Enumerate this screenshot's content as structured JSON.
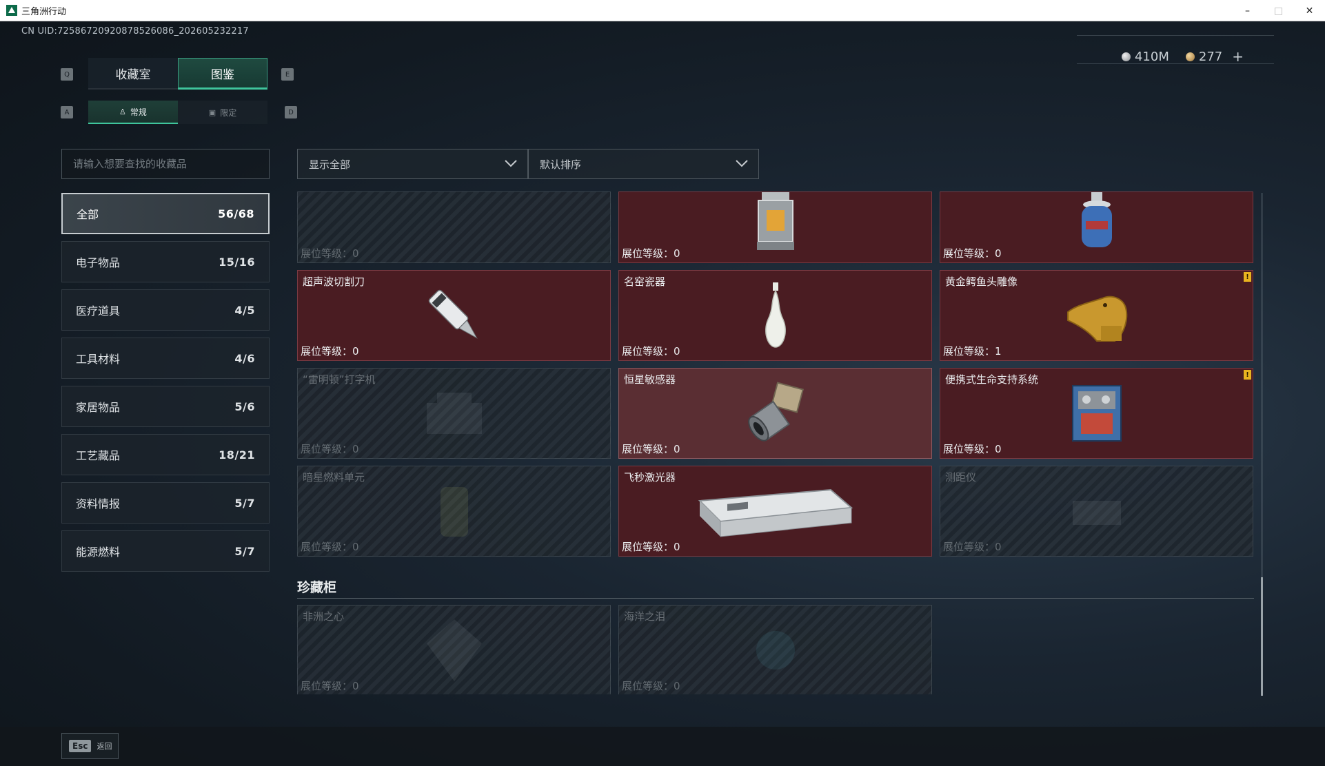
{
  "window": {
    "title": "三角洲行动",
    "minimize": "–",
    "maximize": "□",
    "close": "✕"
  },
  "uid": "CN UID:7258672092087852608​6_202605232217",
  "currency": {
    "silver": "410M",
    "gold": "277",
    "plus": "+"
  },
  "keys": {
    "q": "Q",
    "e": "E",
    "a": "A",
    "d": "D"
  },
  "main_tabs": [
    {
      "label": "收藏室",
      "active": false
    },
    {
      "label": "图鉴",
      "active": true
    }
  ],
  "sub_tabs": [
    {
      "label": "常规",
      "icon": "figure-icon",
      "active": true
    },
    {
      "label": "限定",
      "icon": "image-icon",
      "active": false
    }
  ],
  "search": {
    "placeholder": "请输入想要查找的收藏品",
    "value": ""
  },
  "filters": {
    "show": "显示全部",
    "sort": "默认排序"
  },
  "categories": [
    {
      "label": "全部",
      "count": "56/68",
      "active": true
    },
    {
      "label": "电子物品",
      "count": "15/16"
    },
    {
      "label": "医疗道具",
      "count": "4/5"
    },
    {
      "label": "工具材料",
      "count": "4/6"
    },
    {
      "label": "家居物品",
      "count": "5/6"
    },
    {
      "label": "工艺藏品",
      "count": "18/21"
    },
    {
      "label": "资料情报",
      "count": "5/7"
    },
    {
      "label": "能源燃料",
      "count": "5/7"
    }
  ],
  "items": [
    {
      "name": "",
      "level": "展位等级：0",
      "state": "locked",
      "icon": "unknown-item-icon"
    },
    {
      "name": "",
      "level": "展位等级：0",
      "state": "owned",
      "icon": "lantern-icon"
    },
    {
      "name": "",
      "level": "展位等级：0",
      "state": "owned",
      "icon": "gas-canister-icon"
    },
    {
      "name": "超声波切割刀",
      "level": "展位等级：0",
      "state": "owned",
      "icon": "ultrasonic-cutter-icon"
    },
    {
      "name": "名窑瓷器",
      "level": "展位等级：0",
      "state": "owned",
      "icon": "porcelain-vase-icon"
    },
    {
      "name": "黄金鳄鱼头雕像",
      "level": "展位等级：1",
      "state": "owned",
      "icon": "gold-crocodile-statue-icon",
      "warn": "!"
    },
    {
      "name": "“雷明顿”打字机",
      "level": "展位等级：0",
      "state": "locked",
      "icon": "typewriter-icon"
    },
    {
      "name": "恒星敏感器",
      "level": "展位等级：0",
      "state": "owned-hi",
      "icon": "star-sensor-icon"
    },
    {
      "name": "便携式生命支持系统",
      "level": "展位等级：0",
      "state": "owned",
      "icon": "life-support-icon",
      "warn": "!"
    },
    {
      "name": "暗星燃料单元",
      "level": "展位等级：0",
      "state": "locked",
      "icon": "fuel-cell-icon"
    },
    {
      "name": "飞秒激光器",
      "level": "展位等级：0",
      "state": "owned",
      "icon": "femtosecond-laser-icon"
    },
    {
      "name": "测距仪",
      "level": "展位等级：0",
      "state": "locked",
      "icon": "rangefinder-icon"
    }
  ],
  "treasure_section": {
    "title": "珍藏柜",
    "items": [
      {
        "name": "非洲之心",
        "level": "展位等级：0",
        "state": "locked",
        "icon": "diamond-icon"
      },
      {
        "name": "海洋之泪",
        "level": "展位等级：0",
        "state": "locked",
        "icon": "gem-icon"
      }
    ]
  },
  "footer": {
    "esc_key": "Esc",
    "back_label": "返回"
  },
  "colors": {
    "accent": "#3fc59c",
    "owned_card": "#4a1c22",
    "warn": "#e8b31f"
  }
}
